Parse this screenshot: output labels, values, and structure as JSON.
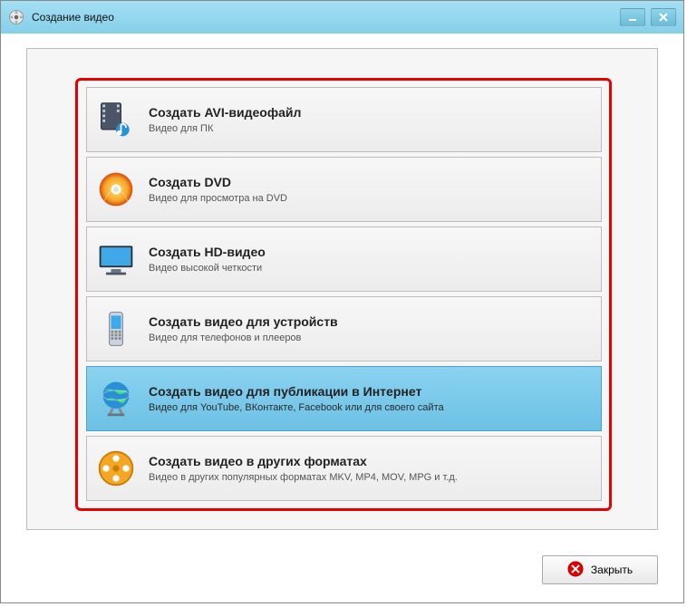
{
  "window": {
    "title": "Создание видео"
  },
  "options": [
    {
      "title": "Создать AVI-видеофайл",
      "subtitle": "Видео для ПК",
      "icon": "avi"
    },
    {
      "title": "Создать DVD",
      "subtitle": "Видео для просмотра на DVD",
      "icon": "dvd"
    },
    {
      "title": "Создать HD-видео",
      "subtitle": "Видео высокой четкости",
      "icon": "hd"
    },
    {
      "title": "Создать видео для устройств",
      "subtitle": "Видео для телефонов и плееров",
      "icon": "mobile"
    },
    {
      "title": "Создать видео для публикации в Интернет",
      "subtitle": "Видео для YouTube, ВКонтакте, Facebook или для своего сайта",
      "icon": "globe"
    },
    {
      "title": "Создать видео в других форматах",
      "subtitle": "Видео в других популярных форматах MKV, MP4, MOV, MPG и т.д.",
      "icon": "reel"
    }
  ],
  "selected_index": 4,
  "footer": {
    "close_label": "Закрыть"
  }
}
